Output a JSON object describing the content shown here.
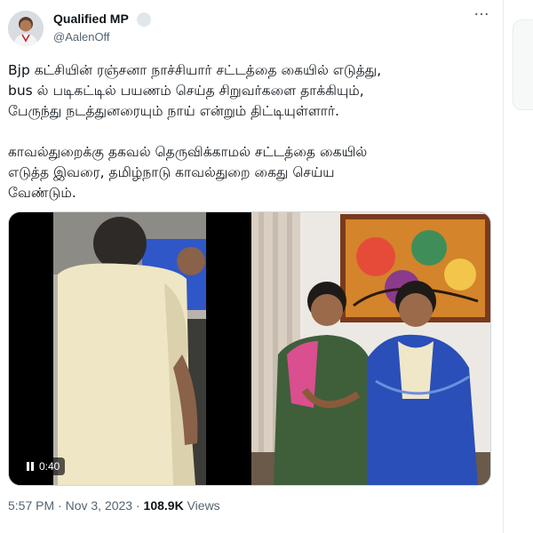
{
  "author": {
    "name": "Qualified MP",
    "handle": "@AalenOff"
  },
  "tweet": {
    "paragraph1": "Bjp கட்சியின் ரஞ்சனா நாச்சியார் சட்டத்தை கையில் எடுத்து,\nbus ல் படிகட்டில் பயணம் செய்த சிறுவர்களை தாக்கியும்,\nபேருந்து நடத்துனரையும் நாய் என்றும் திட்டியுள்ளார்.",
    "paragraph2": "காவல்துறைக்கு தகவல் தெருவிக்காமல் சட்டத்தை கையில்\nஎடுத்த இவரை, தமிழ்நாடு காவல்துறை கைது செய்ய\nவேண்டும்."
  },
  "media": {
    "video_duration": "0:40"
  },
  "meta": {
    "time": "5:57 PM",
    "separator": "·",
    "date": "Nov 3, 2023",
    "views": "108.9K",
    "views_label": "Views"
  },
  "icons": {
    "more": "more-icon",
    "badge": "verified-badge-icon",
    "pause": "pause-icon"
  },
  "colors": {
    "text_primary": "#0f1419",
    "text_secondary": "#536471",
    "border": "#cfd9de"
  }
}
